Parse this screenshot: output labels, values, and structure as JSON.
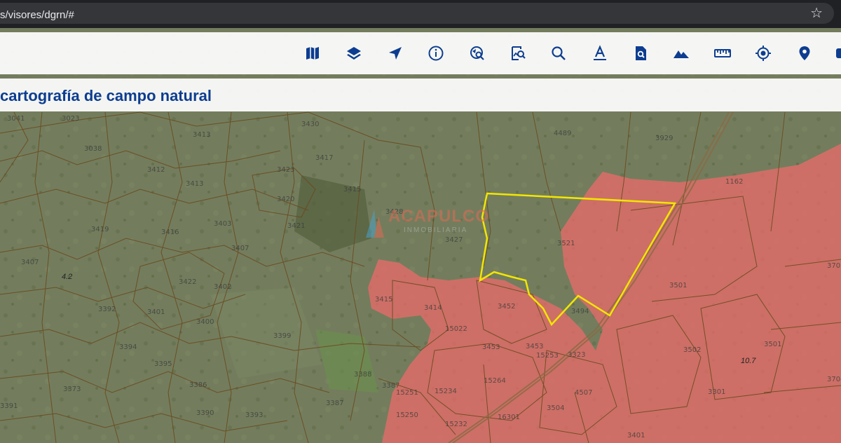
{
  "browser": {
    "url": "s/visores/dgrn/#",
    "bookmark_icon": "star-icon"
  },
  "toolbar": {
    "tools": [
      {
        "name": "basemap-icon"
      },
      {
        "name": "layers-icon"
      },
      {
        "name": "navigate-icon"
      },
      {
        "name": "info-icon"
      },
      {
        "name": "search-map-icon"
      },
      {
        "name": "image-search-icon"
      },
      {
        "name": "search-icon"
      },
      {
        "name": "text-annotation-icon"
      },
      {
        "name": "document-search-icon"
      },
      {
        "name": "terrain-icon"
      },
      {
        "name": "ruler-icon"
      },
      {
        "name": "locate-icon"
      },
      {
        "name": "location-pin-icon"
      },
      {
        "name": "more-tool-icon"
      }
    ]
  },
  "header": {
    "title": "cartografía de campo natural"
  },
  "watermark": {
    "name": "ACAPULCO",
    "subtitle": "INMOBILIARIA"
  },
  "map_labels": {
    "zone_a": "4.2",
    "zone_b": "10.7"
  },
  "colors": {
    "title": "#0d3d91",
    "toolbar_icon": "#0d3d91",
    "overlay_red": "#f06a6a",
    "parcel_highlight": "#f2e600",
    "parcel_lines": "#6b4a1e"
  }
}
